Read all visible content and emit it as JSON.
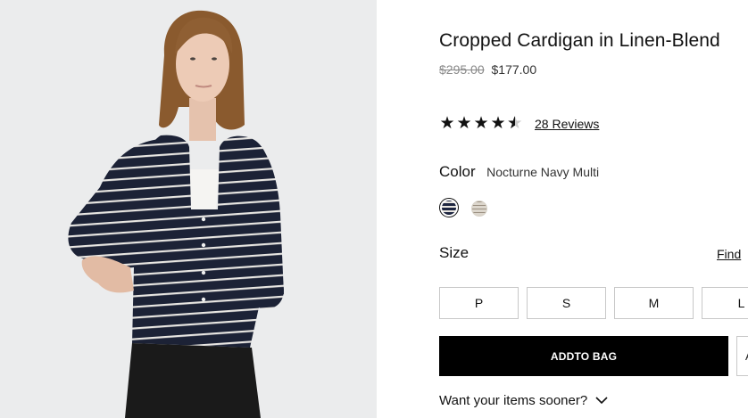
{
  "product": {
    "title": "Cropped Cardigan in Linen-Blend",
    "original_price": "$295.00",
    "sale_price": "$177.00",
    "rating": 4.5,
    "reviews_label": "28 Reviews"
  },
  "color": {
    "label": "Color",
    "selected_value": "Nocturne Navy Multi",
    "swatches": [
      {
        "name": "Nocturne Navy Multi",
        "hex": "#1d2540",
        "selected": true
      },
      {
        "name": "cream stripe",
        "hex": "#dcd6cc",
        "selected": false
      }
    ]
  },
  "size": {
    "label": "Size",
    "find_link": "Find",
    "options": [
      "P",
      "S",
      "M",
      "L"
    ]
  },
  "cta": {
    "add_to_bag": "ADDTO BAG",
    "side_button": "A"
  },
  "shipping": {
    "sooner_label": "Want your items sooner?"
  },
  "image": {
    "icon": "product-photo"
  }
}
